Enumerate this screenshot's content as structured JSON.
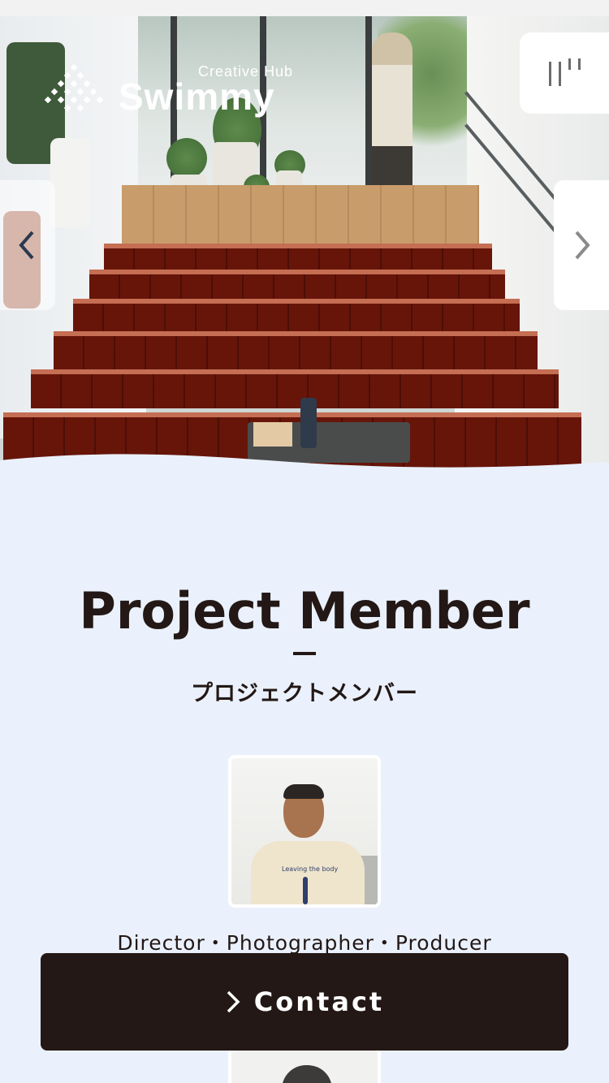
{
  "brand": {
    "tagline": "Creative Hub",
    "name": "Swimmy"
  },
  "header": {
    "menu_icon": "menu-bars-icon"
  },
  "hero": {
    "prev_icon": "chevron-left-icon",
    "next_icon": "chevron-right-icon"
  },
  "section": {
    "title": "Project Member",
    "subtitle": "プロジェクトメンバー"
  },
  "members": [
    {
      "role": "Director・Photographer・Producer",
      "shirt_text": "Leaving the body"
    }
  ],
  "contact": {
    "label": "Contact",
    "icon": "chevron-right-icon"
  },
  "colors": {
    "background": "#eaf1fc",
    "ink": "#231815",
    "button": "#231815"
  }
}
